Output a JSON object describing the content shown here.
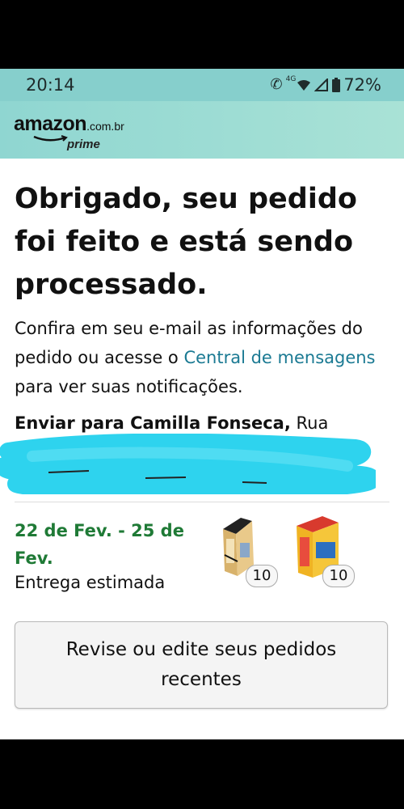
{
  "status_bar": {
    "time": "20:14",
    "network": "4G",
    "battery": "72%"
  },
  "header": {
    "logo_word": "amazon",
    "logo_tld": ".com.br",
    "logo_prime": "prime"
  },
  "confirmation": {
    "headline": "Obrigado, seu pedido foi feito e está sendo processado.",
    "info_before": "Confira em seu e-mail as informações do pedido ou acesse o ",
    "info_link": "Central de mensagens",
    "info_after": " para ver suas notificações.",
    "ship_label": "Enviar para Camilla Fonseca,",
    "ship_address_start": " Rua"
  },
  "delivery": {
    "date_range": "22 de Fev. - 25 de Fev.",
    "label": "Entrega estimada",
    "items": [
      {
        "name": "product-pen-box-1",
        "quantity": "10"
      },
      {
        "name": "product-pen-box-2",
        "quantity": "10"
      }
    ]
  },
  "actions": {
    "review_label": "Revise ou edite seus pedidos recentes"
  },
  "colors": {
    "status_bar": "#86cfcc",
    "header": "#a9e2d6",
    "link": "#1b7a93",
    "delivery_date": "#1f7a36",
    "redaction": "#2ed3ee"
  },
  "icons": [
    "phone-icon",
    "wifi-icon",
    "signal-icon",
    "battery-icon"
  ]
}
